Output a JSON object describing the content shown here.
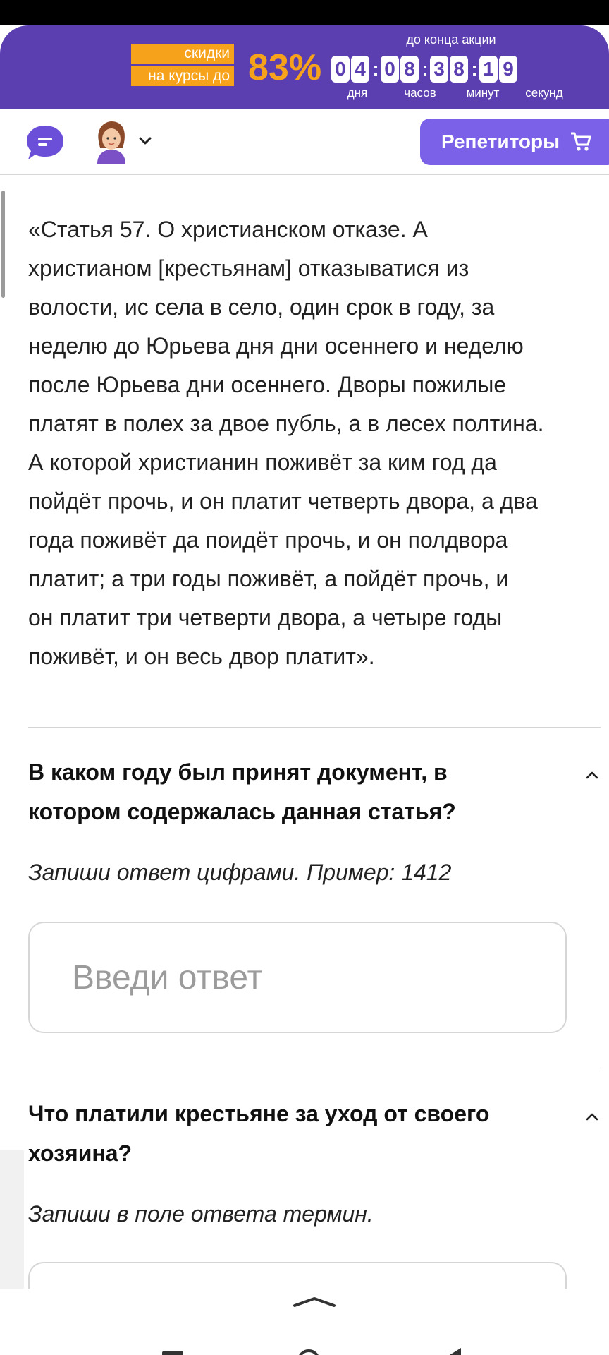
{
  "promo": {
    "tag_line1": "скидки",
    "tag_line2": "на курсы до",
    "percent": "83%",
    "until": "до конца акции",
    "digits": [
      "0",
      "4",
      "0",
      "8",
      "3",
      "8",
      "1",
      "9"
    ],
    "labels": {
      "days": "дня",
      "hours": "часов",
      "minutes": "минут",
      "seconds": "секунд"
    },
    "colors": {
      "background": "#5b3fb0",
      "accent": "#f7a21b"
    }
  },
  "header": {
    "tutors_label": "Репетиторы",
    "icons": [
      "chat-bubble-icon",
      "avatar",
      "chevron-down-icon",
      "cart-icon"
    ],
    "button_color": "#7b61e8"
  },
  "article": {
    "lines": [
      "«Статья 57. О христианском отказе. А",
      "христианом [крестьянам] отказыватися из",
      "волости, ис села в село, один срок в году, за",
      "неделю до Юрьева дня дни осеннего и неделю",
      "после Юрьева дни осеннего. Дворы пожилые",
      "платят в полех за двое публь, а в лесех полтина.",
      "А которой христианин поживёт за ким год да",
      "пойдёт прочь, и он платит четверть двора, а два",
      "года поживёт да поидёт прочь, и он полдвора",
      "платит; а три годы поживёт, а пойдёт прочь, и",
      "он платит три четверти двора, а четыре годы",
      "поживёт, и он весь двор платит»."
    ]
  },
  "questions": [
    {
      "title_line1": "В каком году был принят документ, в",
      "title_line2": "котором содержалась данная статья?",
      "hint": "Запиши ответ цифрами. Пример: 1412",
      "placeholder": "Введи ответ"
    },
    {
      "title_line1": "Что платили крестьяне за уход от своего",
      "title_line2": "хозяина?",
      "hint": "Запиши в поле ответа термин."
    }
  ]
}
